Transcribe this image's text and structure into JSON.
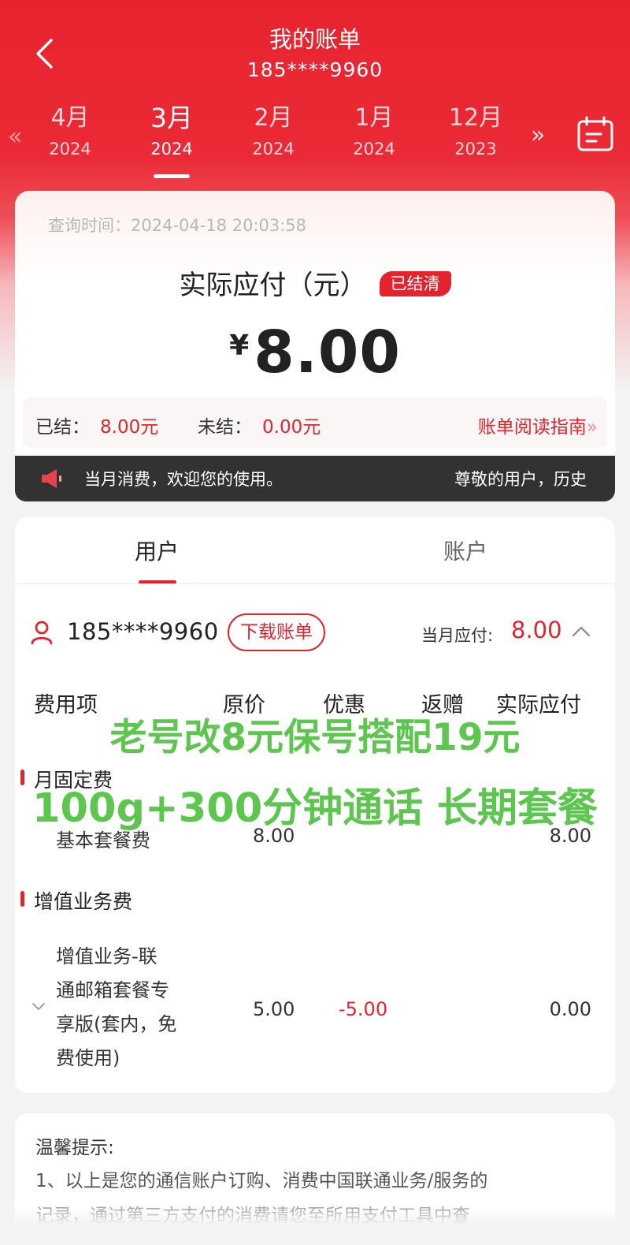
{
  "header": {
    "title": "我的账单",
    "subtitle": "185****9960"
  },
  "months": [
    {
      "month": "4月",
      "year": "2024",
      "active": false
    },
    {
      "month": "3月",
      "year": "2024",
      "active": true
    },
    {
      "month": "2月",
      "year": "2024",
      "active": false
    },
    {
      "month": "1月",
      "year": "2024",
      "active": false
    },
    {
      "month": "12月",
      "year": "2023",
      "active": false
    }
  ],
  "bill": {
    "query_time": "查询时间：2024-04-18 20:03:58",
    "pay_label": "实际应付（元）",
    "status": "已结清",
    "currency": "¥",
    "amount": "8.00",
    "settled_label": "已结：",
    "settled_value": "8.00元",
    "unsettled_label": "未结：",
    "unsettled_value": "0.00元",
    "guide_link": "账单阅读指南"
  },
  "notice": {
    "text1": "当月消费，欢迎您的使用。",
    "text2": "尊敬的用户，历史"
  },
  "tabs": {
    "user": "用户",
    "account": "账户"
  },
  "user_row": {
    "phone": "185****9960",
    "download": "下载账单",
    "month_due_label": "当月应付:",
    "month_due_value": "8.00"
  },
  "table": {
    "headers": [
      "费用项",
      "原价",
      "优惠",
      "返赠",
      "实际应付"
    ],
    "section1": "月固定费",
    "row1": {
      "name": "基本套餐费",
      "original": "8.00",
      "actual": "8.00"
    },
    "section2": "增值业务费",
    "row2": {
      "name_lines": [
        "增值业务-联",
        "通邮箱套餐专",
        "享版(套内，免",
        "费使用)"
      ],
      "original": "5.00",
      "discount": "-5.00",
      "actual": "0.00"
    }
  },
  "overlay": {
    "line1": "老号改8元保号搭配19元",
    "line2": "100g+300分钟通话 长期套餐"
  },
  "tips": {
    "title": "温馨提示:",
    "line1": "1、以上是您的通信账户订购、消费中国联通业务/服务的",
    "line2": "记录，通过第三方支付的消费请您至所用支付工具中查"
  },
  "colors": {
    "brand_red": "#e3242f",
    "overlay_green": "#5cc64e"
  }
}
